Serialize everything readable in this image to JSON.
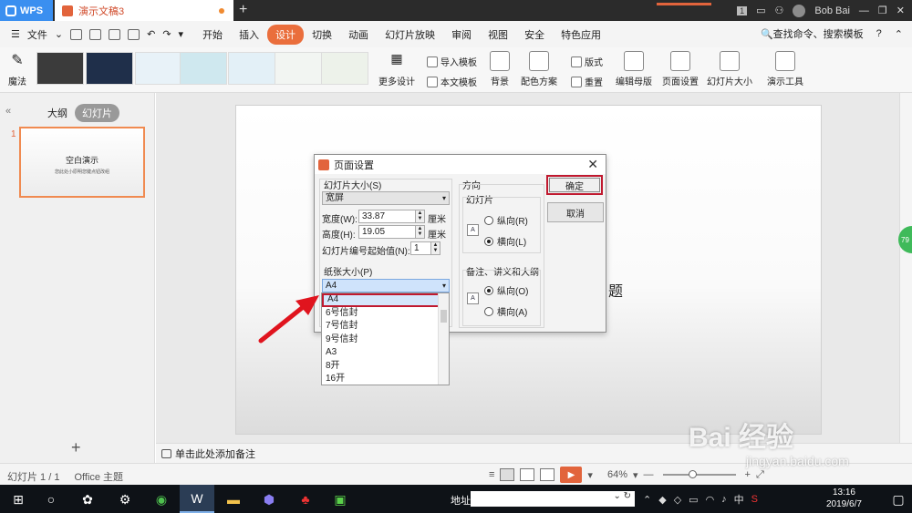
{
  "titlebar": {
    "app_tab": "WPS",
    "doc_tab": "演示文稿3",
    "new_tab": "+",
    "badge": "1",
    "user": "Bob Bai"
  },
  "menubar": {
    "file": "文件",
    "tabs": [
      "开始",
      "插入",
      "设计",
      "切换",
      "动画",
      "幻灯片放映",
      "审阅",
      "视图",
      "安全",
      "特色应用"
    ],
    "active_tab": "设计",
    "search": "查找命令、搜索模板",
    "help": "?"
  },
  "ribbon": {
    "magic": "魔法",
    "more_design": "更多设计",
    "import_template": "导入模板",
    "this_template": "本文模板",
    "background": "背景",
    "color_scheme": "配色方案",
    "layout": "版式",
    "reset": "重置",
    "edit_master": "编辑母版",
    "page_setup": "页面设置",
    "slide_size": "幻灯片大小",
    "presenter_tools": "演示工具"
  },
  "leftpanel": {
    "tab_outline": "大纲",
    "tab_slides": "幻灯片",
    "slide_number": "1",
    "thumb_title": "空白演示",
    "thumb_subtitle": "您此处小原明您键点钮改组"
  },
  "canvas": {
    "visible_text": "题"
  },
  "notes": {
    "placeholder": "单击此处添加备注"
  },
  "statusbar": {
    "slide_counter": "幻灯片 1 / 1",
    "theme": "Office 主题",
    "zoom": "64%"
  },
  "dialog": {
    "title": "页面设置",
    "slide_size_label": "幻灯片大小(S)",
    "slide_size_value": "宽屏",
    "width_label": "宽度(W):",
    "width_value": "33.87",
    "height_label": "高度(H):",
    "height_value": "19.05",
    "unit": "厘米",
    "start_number_label": "幻灯片编号起始值(N):",
    "start_number_value": "1",
    "paper_size_label": "纸张大小(P)",
    "paper_size_value": "A4",
    "orientation_label": "方向",
    "slides_group": "幻灯片",
    "portrait": "纵向(R)",
    "landscape": "横向(L)",
    "notes_group": "备注、讲义和大纲",
    "notes_portrait": "纵向(O)",
    "notes_landscape": "横向(A)",
    "ok": "确定",
    "cancel": "取消",
    "paper_options": [
      "A4",
      "6号信封",
      "7号信封",
      "9号信封",
      "A3",
      "8开",
      "16开"
    ]
  },
  "taskbar": {
    "address_label": "地址",
    "ime": "中",
    "time": "13:16",
    "date": "2019/6/7"
  },
  "watermark": {
    "text": "Bai 经验",
    "url": "jingyan.baidu.com"
  },
  "colors": {
    "accent": "#ea6e3c",
    "wps_blue": "#3a8ff0",
    "highlight_red": "#c0192f"
  }
}
